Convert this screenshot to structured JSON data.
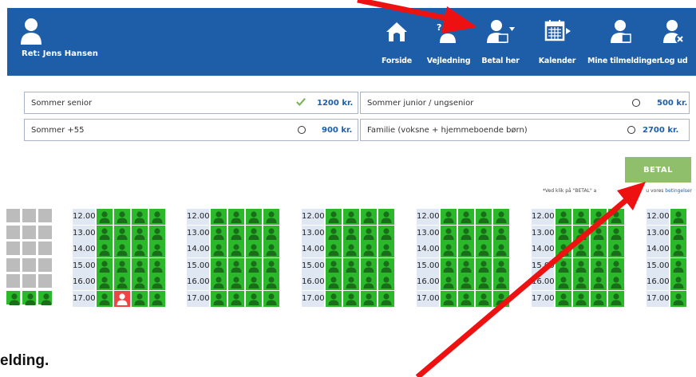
{
  "header": {
    "user_label": "Ret: Jens Hansen",
    "nav": [
      {
        "label": "Forside",
        "icon": "home-icon"
      },
      {
        "label": "Vejledning",
        "icon": "user-help-icon"
      },
      {
        "label": "Betal her",
        "icon": "user-payment-icon"
      },
      {
        "label": "Kalender",
        "icon": "calendar-icon"
      },
      {
        "label": "Mine tilmeldinger",
        "icon": "user-bookings-icon"
      },
      {
        "label": "Log ud",
        "icon": "logout-icon"
      }
    ]
  },
  "options": [
    {
      "name": "Sommer senior",
      "price": "1200 kr.",
      "selected": true
    },
    {
      "name": "Sommer junior / ungsenior",
      "price": "500 kr.",
      "selected": false
    },
    {
      "name": "Sommer +55",
      "price": "900 kr.",
      "selected": false
    },
    {
      "name": "Familie (voksne + hjemmeboende børn)",
      "price": "2700 kr.",
      "selected": false
    }
  ],
  "pay": {
    "button_label": "BETAL",
    "note": "*Ved klik på \"BETAL\" a",
    "note_tail": "u vores ",
    "note_link": "betingelser"
  },
  "grid": {
    "times": [
      "12.00",
      "13.00",
      "14.00",
      "15.00",
      "16.00",
      "17.00"
    ],
    "taken": [
      {
        "day": 0,
        "row": 5,
        "col": 1
      }
    ]
  },
  "bottom_text": "elding.",
  "colors": {
    "header": "#1e5ea8",
    "slot_available": "#2bb82b",
    "slot_taken": "#e44444",
    "pay_button": "#8fbf6a",
    "annotation_arrow": "#e11"
  }
}
